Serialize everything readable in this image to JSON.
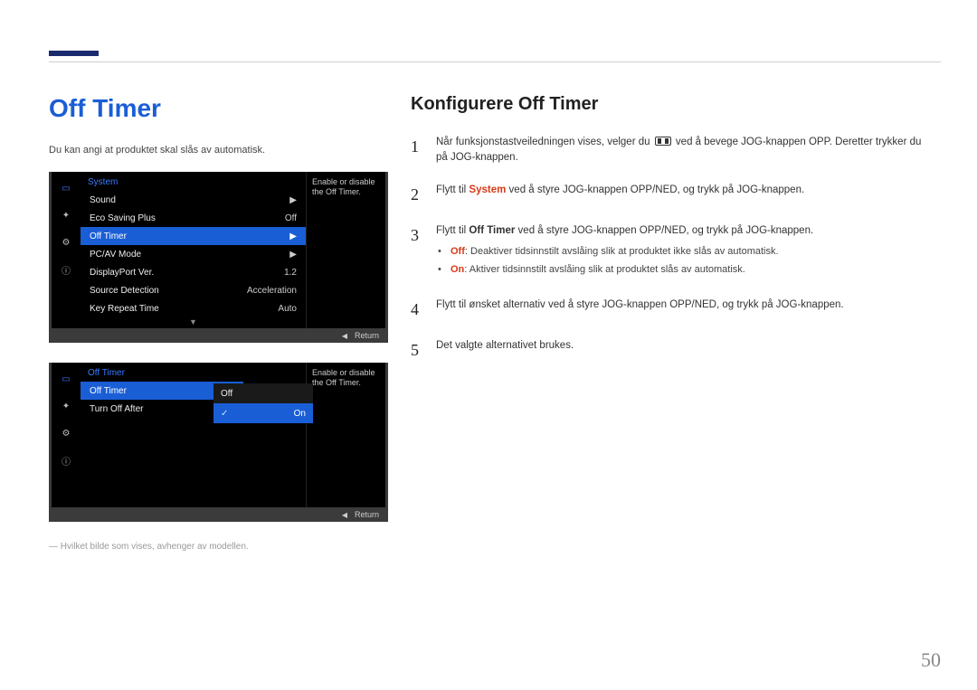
{
  "page_number": "50",
  "left": {
    "title": "Off Timer",
    "intro": "Du kan angi at produktet skal slås av automatisk.",
    "footnote": "― Hvilket bilde som vises, avhenger av modellen."
  },
  "osd1": {
    "header": "System",
    "desc": "Enable or disable the Off Timer.",
    "rows": [
      {
        "label": "Sound",
        "value": "▶",
        "sel": false
      },
      {
        "label": "Eco Saving Plus",
        "value": "Off",
        "sel": false
      },
      {
        "label": "Off Timer",
        "value": "▶",
        "sel": true
      },
      {
        "label": "PC/AV Mode",
        "value": "▶",
        "sel": false
      },
      {
        "label": "DisplayPort Ver.",
        "value": "1.2",
        "sel": false
      },
      {
        "label": "Source Detection",
        "value": "Acceleration",
        "sel": false
      },
      {
        "label": "Key Repeat Time",
        "value": "Auto",
        "sel": false
      }
    ],
    "return": "Return"
  },
  "osd2": {
    "header": "Off Timer",
    "desc": "Enable or disable the Off Timer.",
    "rows": [
      {
        "label": "Off Timer",
        "value": "Off",
        "sel": true
      },
      {
        "label": "Turn Off After",
        "value": "",
        "sel": false
      }
    ],
    "popup": [
      {
        "label": "Off",
        "sel": false
      },
      {
        "label": "On",
        "sel": true
      }
    ],
    "return": "Return"
  },
  "right": {
    "title": "Konfigurere Off Timer",
    "steps": {
      "s1a": "Når funksjonstastveiledningen vises, velger du ",
      "s1b": " ved å bevege JOG-knappen OPP. Deretter trykker du på JOG-knappen.",
      "s2a": "Flytt til ",
      "s2_sys": "System",
      "s2b": " ved å styre JOG-knappen OPP/NED, og trykk på JOG-knappen.",
      "s3a": "Flytt til ",
      "s3_ot": "Off Timer",
      "s3b": " ved å styre JOG-knappen OPP/NED, og trykk på JOG-knappen.",
      "b_off_l": "Off",
      "b_off_t": ": Deaktiver tidsinnstilt avslåing slik at produktet ikke slås av automatisk.",
      "b_on_l": "On",
      "b_on_t": ": Aktiver tidsinnstilt avslåing slik at produktet slås av automatisk.",
      "s4": "Flytt til ønsket alternativ ved å styre JOG-knappen OPP/NED, og trykk på JOG-knappen.",
      "s5": "Det valgte alternativet brukes."
    }
  }
}
